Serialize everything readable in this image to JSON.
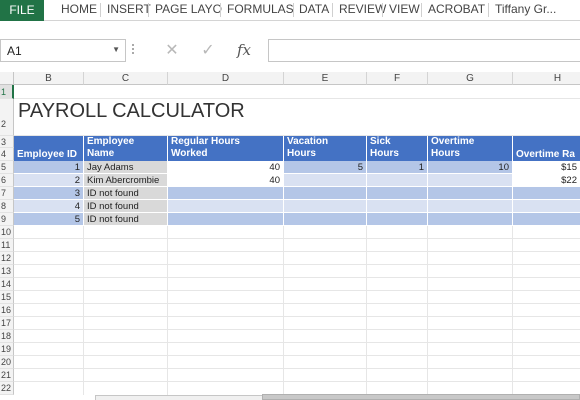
{
  "ribbon": {
    "file_tab": "FILE",
    "tabs": [
      "HOME",
      "INSERT",
      "PAGE LAYO",
      "FORMULAS",
      "DATA",
      "REVIEW",
      "VIEW",
      "ACROBAT"
    ],
    "user": "Tiffany Gr..."
  },
  "formula_bar": {
    "name_box": "A1",
    "cancel_icon": "✕",
    "enter_icon": "✓",
    "fx_label": "fx",
    "formula_value": ""
  },
  "columns": [
    "B",
    "C",
    "D",
    "E",
    "F",
    "G",
    "H"
  ],
  "rows": [
    "1",
    "2",
    "3",
    "4",
    "5",
    "6",
    "7",
    "8",
    "9",
    "10",
    "11",
    "12",
    "13",
    "14",
    "15",
    "16",
    "17",
    "18",
    "19",
    "20",
    "21",
    "22"
  ],
  "sheet": {
    "title": "PAYROLL CALCULATOR",
    "headers": {
      "employee_id": "Employee ID",
      "employee_name_l1": "Employee",
      "employee_name_l2": "Name",
      "regular_l1": "Regular Hours",
      "regular_l2": "Worked",
      "vacation_l1": "Vacation",
      "vacation_l2": "Hours",
      "sick_l1": "Sick",
      "sick_l2": "Hours",
      "overtime_l1": "Overtime",
      "overtime_l2": "Hours",
      "overtime_rate": "Overtime Ra"
    },
    "rows": [
      {
        "id": "1",
        "name": "Jay Adams",
        "regular": "40",
        "vacation": "5",
        "sick": "1",
        "overtime": "10",
        "rate": "$15"
      },
      {
        "id": "2",
        "name": "Kim Abercrombie",
        "regular": "40",
        "vacation": "",
        "sick": "",
        "overtime": "",
        "rate": "$22"
      },
      {
        "id": "3",
        "name": "ID not found",
        "regular": "",
        "vacation": "",
        "sick": "",
        "overtime": "",
        "rate": ""
      },
      {
        "id": "4",
        "name": "ID not found",
        "regular": "",
        "vacation": "",
        "sick": "",
        "overtime": "",
        "rate": ""
      },
      {
        "id": "5",
        "name": "ID not found",
        "regular": "",
        "vacation": "",
        "sick": "",
        "overtime": "",
        "rate": ""
      }
    ]
  },
  "colors": {
    "file_tab": "#217346",
    "header_fill": "#4472c4",
    "band_dark": "#b4c6e7",
    "band_light": "#d9e1f2",
    "name_cell_gray": "#d9d9d9"
  }
}
